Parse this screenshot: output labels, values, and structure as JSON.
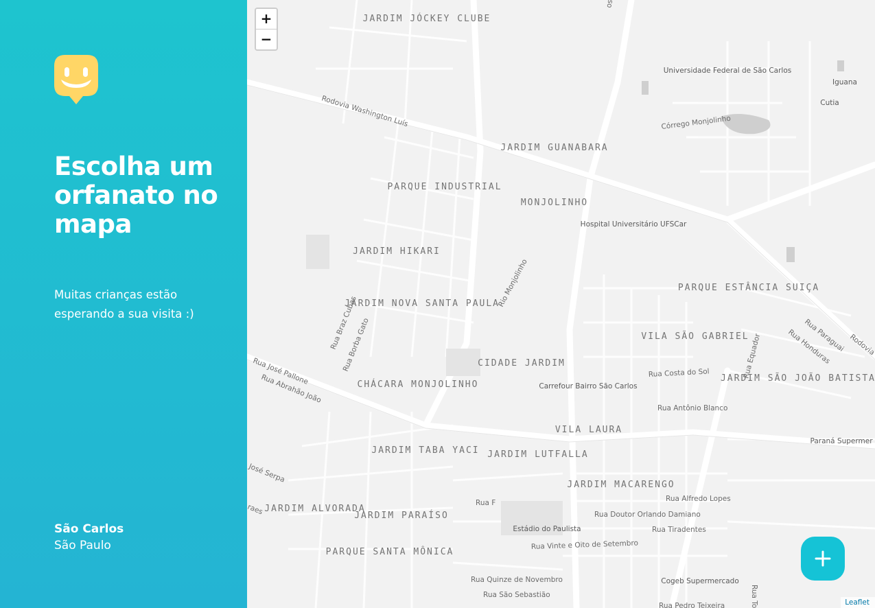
{
  "sidebar": {
    "headline": "Escolha um orfanato no mapa",
    "subtitle": "Muitas crianças estão esperando a sua visita :)",
    "city": "São Carlos",
    "state": "São Paulo",
    "logo_icon": "smiley-marker-icon",
    "bg_gradient": [
      "#1ec4cf",
      "#24b4d3"
    ],
    "logo_color": "#ffd666"
  },
  "map": {
    "zoom_in_label": "+",
    "zoom_out_label": "−",
    "attribution": "Leaflet",
    "add_button_icon": "plus-icon",
    "add_button_color": "#15c3d6",
    "neighborhoods": [
      "JARDIM JÓCKEY CLUBE",
      "JARDIM GUANABARA",
      "PARQUE INDUSTRIAL",
      "MONJOLINHO",
      "JARDIM HIKARI",
      "JARDIM NOVA SANTA PAULA",
      "CIDADE JARDIM",
      "CHÁCARA MONJOLINHO",
      "VILA SÃO GABRIEL",
      "PARQUE ESTÂNCIA SUIÇA",
      "JARDIM SÃO JOÃO BATISTA",
      "VILA LAURA",
      "JARDIM TABA YACI",
      "JARDIM LUTFALLA",
      "JARDIM MACARENGO",
      "JARDIM ALVORADA",
      "JARDIM PARAÍSO",
      "PARQUE SANTA MÔNICA"
    ],
    "roads": [
      "Rodovia Washington Luís",
      "Córrego Monjolinho",
      "Rio Monjolinho",
      "Rua Braz Cubas",
      "Rua Borba Gato",
      "Rua José Pallone",
      "Rua Abrahão João",
      "Rua Costa do Sol",
      "Rua Antônio Blanco",
      "Rua Equador",
      "Rua Paraguai",
      "Rua Honduras",
      "Rua Alfredo Lopes",
      "Rua Doutor Orlando Damiano",
      "Rua Tiradentes",
      "Rua Vinte e Oito de Setembro",
      "Rua Quinze de Novembro",
      "Rua São Sebastião",
      "Rua F",
      "Rodovia",
      "José Serpa",
      "raes",
      "Rua Pedro Teixeira",
      "Rua Totó",
      "osa"
    ],
    "pois": [
      "Universidade Federal de São Carlos",
      "Iguana",
      "Cutia",
      "Hospital Universitário UFSCar",
      "Carrefour Bairro São Carlos",
      "Estádio do Paulista",
      "Cogeb Supermercado",
      "Paraná Supermer"
    ]
  }
}
